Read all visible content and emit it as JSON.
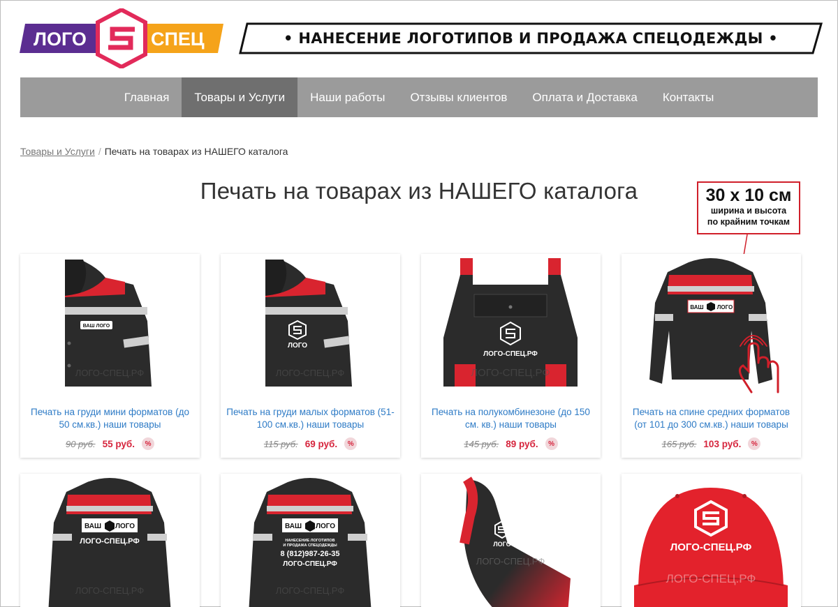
{
  "header": {
    "logo_left": "ЛОГО",
    "logo_right": "СПЕЦ",
    "tagline": "• НАНЕСЕНИЕ ЛОГОТИПОВ И ПРОДАЖА СПЕЦОДЕЖДЫ •"
  },
  "nav": {
    "items": [
      {
        "label": "Главная",
        "active": false
      },
      {
        "label": "Товары и Услуги",
        "active": true
      },
      {
        "label": "Наши работы",
        "active": false
      },
      {
        "label": "Отзывы клиентов",
        "active": false
      },
      {
        "label": "Оплата и Доставка",
        "active": false
      },
      {
        "label": "Контакты",
        "active": false
      }
    ]
  },
  "breadcrumb": {
    "link": "Товары и Услуги",
    "separator": "/",
    "current": "Печать на товарах из НАШЕГО каталога"
  },
  "page_title": "Печать на товарах из НАШЕГО каталога",
  "size_note": {
    "size": "30 x 10 см",
    "line1": "ширина  и  высота",
    "line2": "по крайним точкам"
  },
  "product_labels": {
    "your_logo_a": "ВАШ",
    "your_logo_b": "ЛОГО",
    "logo": "ЛОГО",
    "site": "ЛОГО-СПЕЦ.РФ",
    "phone": "8 (812)987-26-35",
    "slogan_1": "НАНЕСЕНИЕ ЛОГОТИПОВ",
    "slogan_2": "И ПРОДАЖА СПЕЦОДЕЖДЫ",
    "watermark": "ЛОГО-СПЕЦ.РФ"
  },
  "products": [
    {
      "title": "Печать на груди мини форматов (до 50 см.кв.) наши товары",
      "old_price": "90 руб.",
      "new_price": "55 руб.",
      "badge": "%"
    },
    {
      "title": "Печать на груди малых форматов (51-100 см.кв.) наши товары",
      "old_price": "115 руб.",
      "new_price": "69 руб.",
      "badge": "%"
    },
    {
      "title": "Печать на полукомбинезоне (до 150 см. кв.) наши товары",
      "old_price": "145 руб.",
      "new_price": "89 руб.",
      "badge": "%"
    },
    {
      "title": "Печать на спине средних форматов (от 101 до 300 см.кв.) наши товары",
      "old_price": "165 руб.",
      "new_price": "103 руб.",
      "badge": "%"
    }
  ],
  "colors": {
    "nav_bg": "#9b9b9b",
    "nav_active": "#6f6f6f",
    "link": "#2e7bc6",
    "price_red": "#d6253d",
    "jacket_dark": "#2b2b2b",
    "jacket_red": "#d9242f",
    "logo_purple": "#5b2d91",
    "logo_orange": "#f5a31a"
  }
}
